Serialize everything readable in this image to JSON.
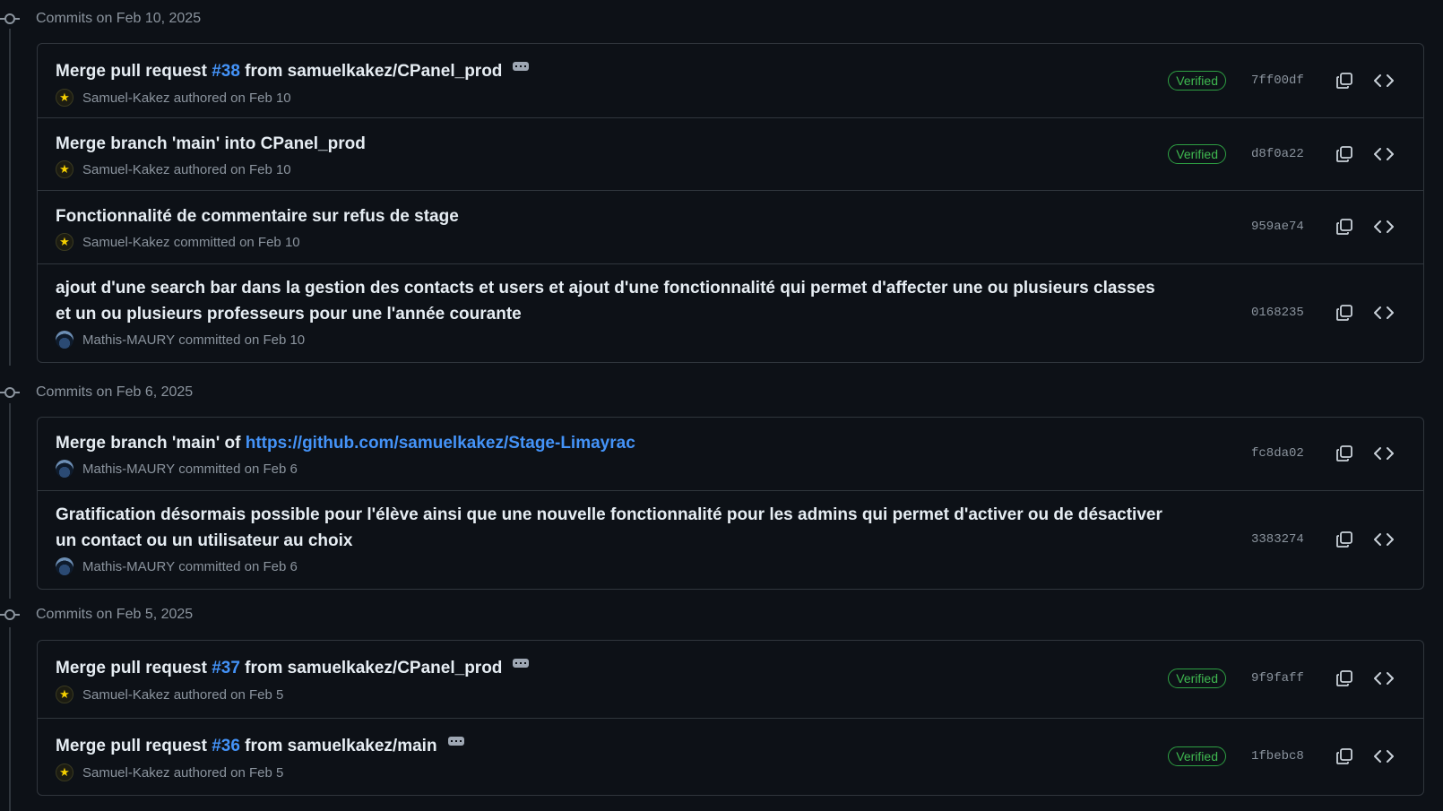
{
  "groups": [
    {
      "title": "Commits on Feb 10, 2025",
      "commits": [
        {
          "message_pre": "Merge pull request ",
          "link": "#38",
          "message_post": " from samuelkakez/CPanel_prod",
          "has_ellipsis": true,
          "author": "Samuel-Kakez",
          "action": "authored on Feb 10",
          "avatar": "star-avatar",
          "verified": "Verified",
          "sha": "7ff00df"
        },
        {
          "message_pre": "Merge branch 'main' into CPanel_prod",
          "author": "Samuel-Kakez",
          "action": "authored on Feb 10",
          "avatar": "star-avatar",
          "verified": "Verified",
          "sha": "d8f0a22"
        },
        {
          "message_pre": "Fonctionnalité de commentaire sur refus de stage",
          "author": "Samuel-Kakez",
          "action": "committed on Feb 10",
          "avatar": "star-avatar",
          "sha": "959ae74"
        },
        {
          "message_pre": "ajout d'une search bar dans la gestion des contacts et users et ajout d'une fonctionnalité qui permet d'affecter une ou plusieurs classes et un ou plusieurs professeurs pour une l'année courante",
          "author": "Mathis-MAURY",
          "action": "committed on Feb 10",
          "avatar": "photo-avatar",
          "sha": "0168235"
        }
      ]
    },
    {
      "title": "Commits on Feb 6, 2025",
      "commits": [
        {
          "message_pre": "Merge branch 'main' of ",
          "link": "https://github.com/samuelkakez/Stage-Limayrac",
          "author": "Mathis-MAURY",
          "action": "committed on Feb 6",
          "avatar": "photo-avatar",
          "sha": "fc8da02"
        },
        {
          "message_pre": "Gratification désormais possible pour l'élève ainsi que une nouvelle fonctionnalité pour les admins qui permet d'activer ou de désactiver un contact ou un utilisateur au choix",
          "author": "Mathis-MAURY",
          "action": "committed on Feb 6",
          "avatar": "photo-avatar",
          "sha": "3383274"
        }
      ]
    },
    {
      "title": "Commits on Feb 5, 2025",
      "commits": [
        {
          "message_pre": "Merge pull request ",
          "link": "#37",
          "message_post": " from samuelkakez/CPanel_prod",
          "has_ellipsis": true,
          "author": "Samuel-Kakez",
          "action": "authored on Feb 5",
          "avatar": "star-avatar",
          "verified": "Verified",
          "sha": "9f9faff"
        },
        {
          "message_pre": "Merge pull request ",
          "link": "#36",
          "message_post": " from samuelkakez/main",
          "has_ellipsis": true,
          "author": "Samuel-Kakez",
          "action": "authored on Feb 5",
          "avatar": "star-avatar",
          "verified": "Verified",
          "sha": "1fbebc8"
        }
      ]
    }
  ],
  "icons": {
    "copy": "copy-icon",
    "browse": "code-brackets-icon",
    "node": "git-commit-icon",
    "star": "star-icon"
  },
  "colors": {
    "background": "#0d1117",
    "border": "#30363d",
    "link": "#4493f8",
    "verified": "#3fb950",
    "muted": "#8b949e"
  }
}
